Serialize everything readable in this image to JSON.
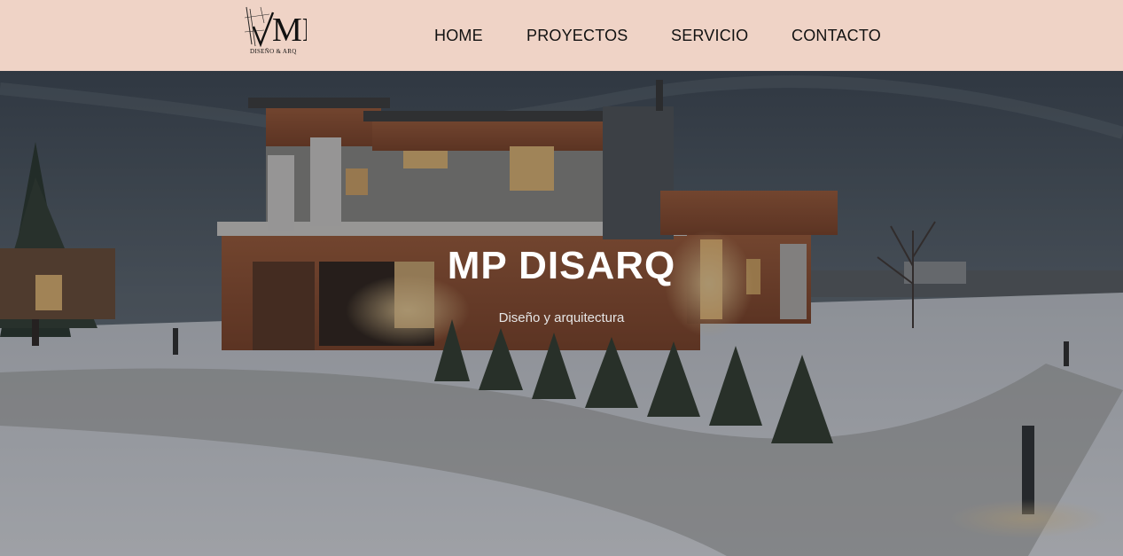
{
  "brand": {
    "logo_text": "MP",
    "logo_sub": "DISEÑO & ARQ"
  },
  "nav": {
    "items": [
      {
        "label": "HOME"
      },
      {
        "label": "PROYECTOS"
      },
      {
        "label": "SERVICIO"
      },
      {
        "label": "CONTACTO"
      }
    ]
  },
  "hero": {
    "title": "MP DISARQ",
    "subtitle": "Diseño y arquitectura"
  },
  "colors": {
    "navbar_bg": "#efd3c6",
    "nav_text": "#111111",
    "hero_title": "#ffffff",
    "hero_subtitle": "#e6e6e6"
  }
}
